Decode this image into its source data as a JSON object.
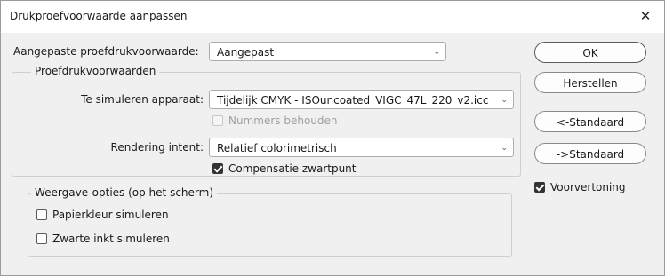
{
  "window": {
    "title": "Drukproefvoorwaarde aanpassen",
    "close_glyph": "✕"
  },
  "custom_condition": {
    "label": "Aangepaste proefdrukvoorwaarde:",
    "value": "Aangepast"
  },
  "proof_conditions": {
    "legend": "Proefdrukvoorwaarden",
    "device_label": "Te simuleren apparaat:",
    "device_value": "Tijdelijk CMYK - ISOuncoated_VIGC_47L_220_v2.icc",
    "preserve_numbers": {
      "label": "Nummers behouden",
      "checked": false,
      "disabled": true
    },
    "rendering_label": "Rendering intent:",
    "rendering_value": "Relatief colorimetrisch",
    "black_point": {
      "label": "Compensatie zwartpunt",
      "checked": true
    }
  },
  "display_options": {
    "legend": "Weergave-opties (op het scherm)",
    "paper_color": {
      "label": "Papierkleur simuleren",
      "checked": false
    },
    "black_ink": {
      "label": "Zwarte inkt simuleren",
      "checked": false
    }
  },
  "buttons": {
    "ok": "OK",
    "reset": "Herstellen",
    "load": "<-Standaard",
    "save": "->Standaard"
  },
  "preview": {
    "label": "Voorvertoning",
    "checked": true
  },
  "icons": {
    "dropdown": "chevron-down-icon",
    "close": "close-icon",
    "check": "checkmark-icon"
  },
  "colors": {
    "dialog_bg": "#f0f0f0",
    "titlebar_bg": "#ffffff",
    "checkbox_checked": "#333333"
  }
}
